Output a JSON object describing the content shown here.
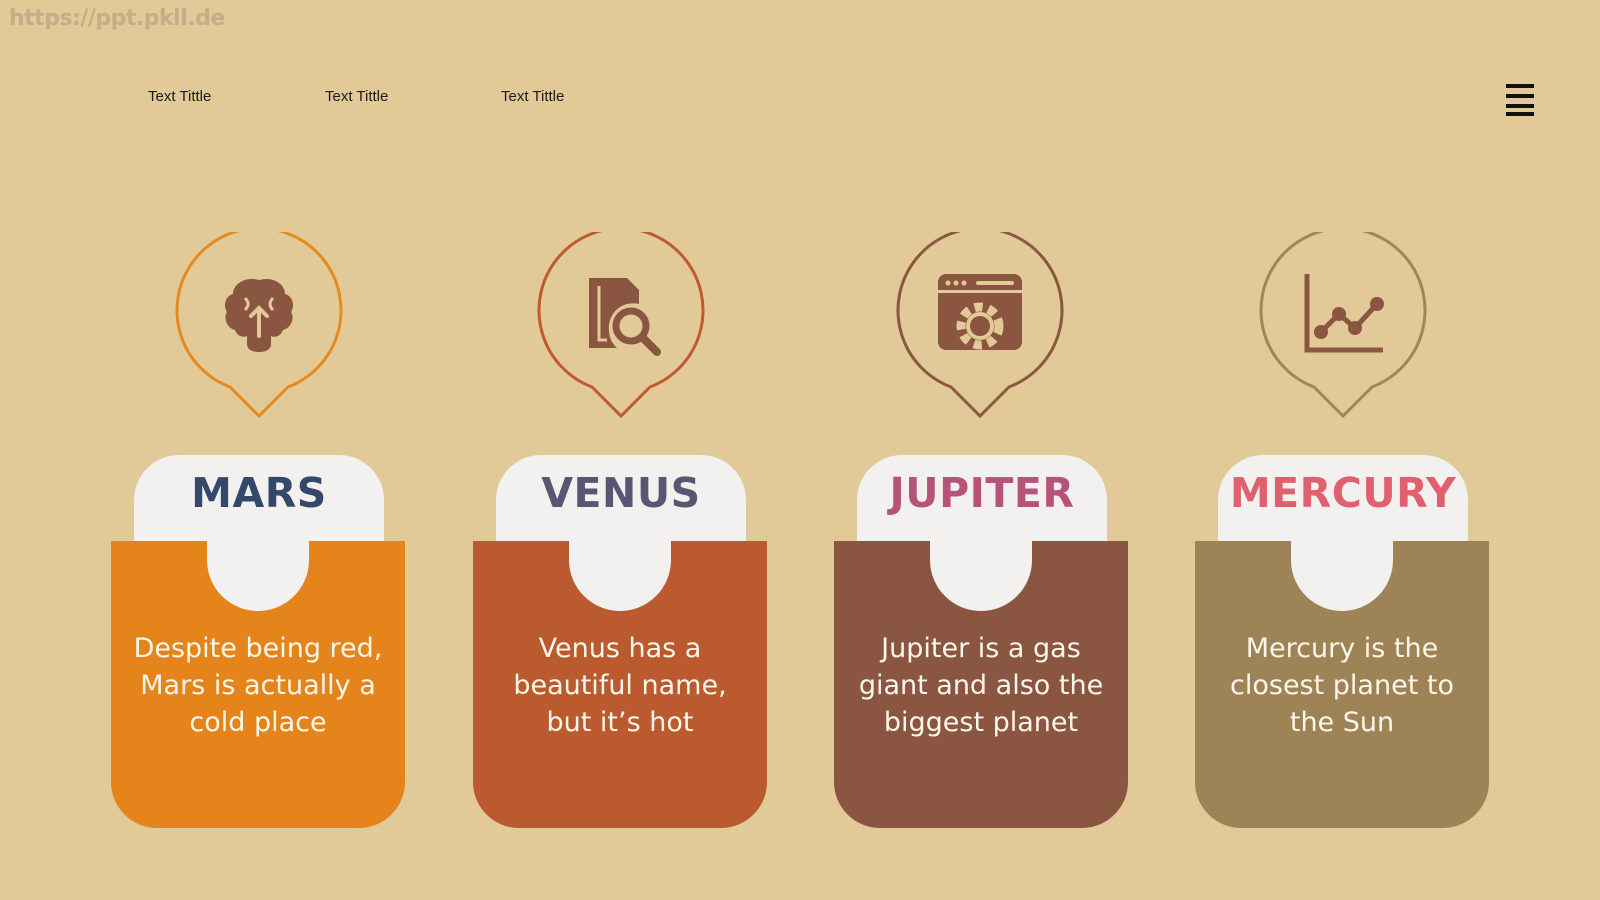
{
  "watermark": "https://ppt.pkll.de",
  "nav": {
    "items": [
      {
        "label": "Text Tittle"
      },
      {
        "label": "Text Tittle"
      },
      {
        "label": "Text Tittle"
      }
    ]
  },
  "menu": {
    "icon": "hamburger-menu-icon"
  },
  "colors": {
    "background": "#e2ca98",
    "tab": "#f2f1f0",
    "description_text": "#fdf6ea"
  },
  "cards": [
    {
      "title": "MARS",
      "title_color": "#34496a",
      "accent": "#e5841a",
      "outline": "#e58a1f",
      "icon": "brain-lightbulb-icon",
      "description": "Despite being red, Mars is actually a cold place"
    },
    {
      "title": "VENUS",
      "title_color": "#5a5572",
      "accent": "#bb5a2e",
      "outline": "#c05a30",
      "icon": "document-search-icon",
      "description": "Venus has a beautiful name, but it’s hot"
    },
    {
      "title": "JUPITER",
      "title_color": "#b5537a",
      "accent": "#8a5641",
      "outline": "#8b5740",
      "icon": "browser-settings-icon",
      "description": "Jupiter is a gas giant and also the biggest planet"
    },
    {
      "title": "MERCURY",
      "title_color": "#e06070",
      "accent": "#9e8356",
      "outline": "#a18558",
      "icon": "line-chart-icon",
      "description": "Mercury is the closest planet to the Sun"
    }
  ]
}
